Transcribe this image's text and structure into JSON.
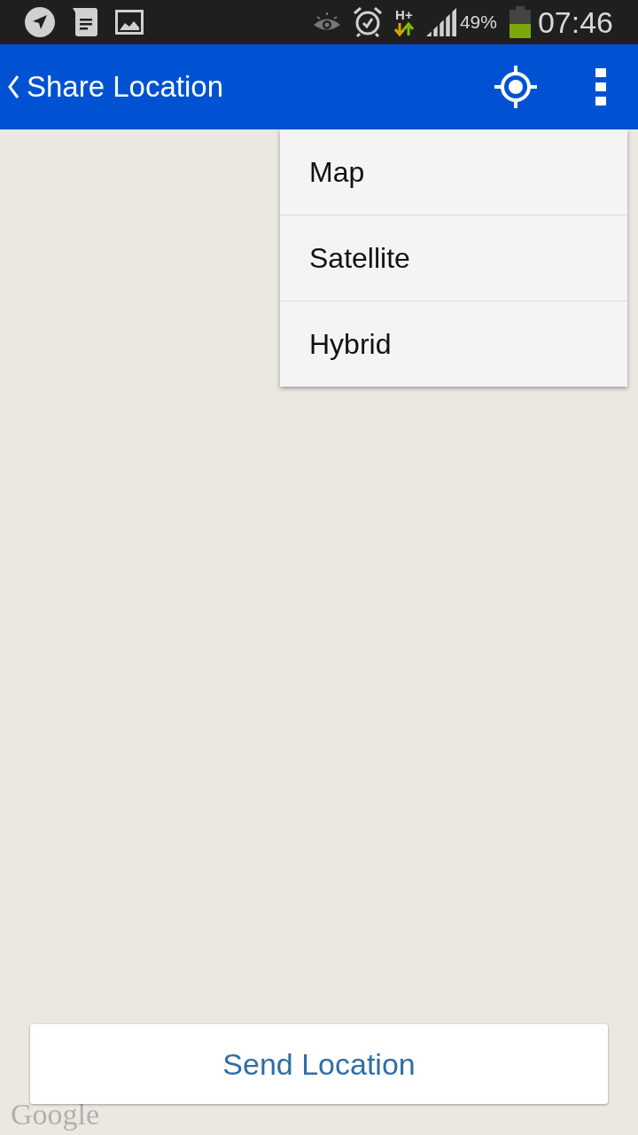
{
  "status_bar": {
    "network": "H+",
    "battery_text": "49%",
    "time": "07:46"
  },
  "app_bar": {
    "title": "Share Location"
  },
  "menu": {
    "items": [
      {
        "label": "Map"
      },
      {
        "label": "Satellite"
      },
      {
        "label": "Hybrid"
      }
    ]
  },
  "map": {
    "attribution": "Google"
  },
  "send_button": {
    "label": "Send Location"
  }
}
